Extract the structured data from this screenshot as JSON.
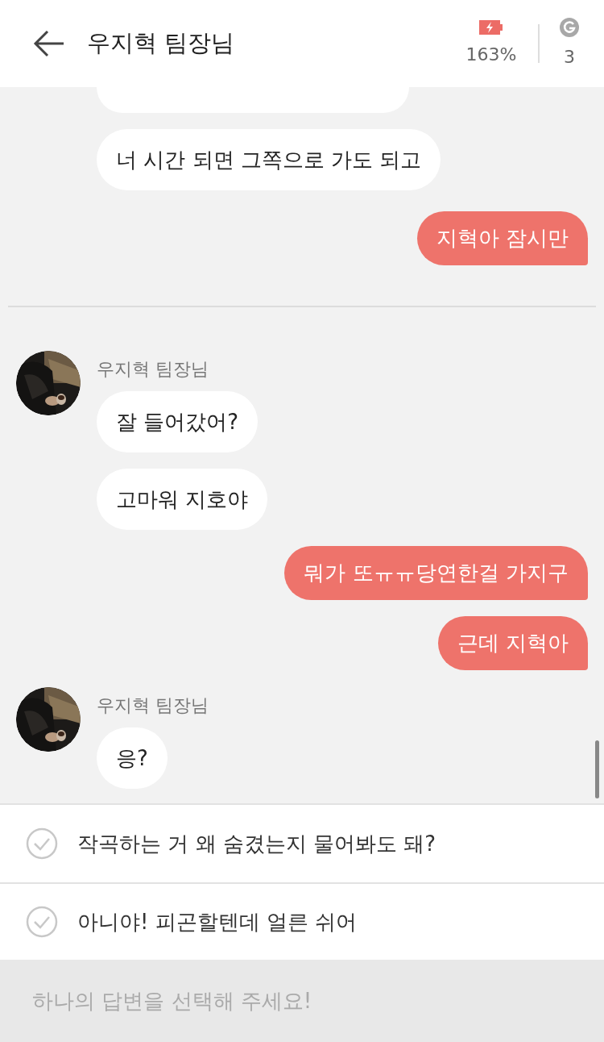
{
  "header": {
    "title": "우지혁 팀장님",
    "battery": "163%",
    "count": "3"
  },
  "messages": [
    {
      "kind": "partial"
    },
    {
      "kind": "received",
      "text": "너 시간 되면 그쪽으로 가도 되고"
    },
    {
      "kind": "sent",
      "text": "지혁아 잠시만"
    },
    {
      "kind": "divider"
    },
    {
      "kind": "group",
      "sender": "우지혁 팀장님",
      "texts": [
        "잘 들어갔어?",
        "고마워 지호야"
      ]
    },
    {
      "kind": "sent",
      "text": "뭐가 또ㅠㅠ당연한걸 가지구"
    },
    {
      "kind": "sent",
      "text": "근데 지혁아"
    },
    {
      "kind": "group",
      "sender": "우지혁 팀장님",
      "texts": [
        "응?"
      ]
    }
  ],
  "options": [
    {
      "text": "작곡하는 거 왜 숨겼는지 물어봐도 돼?",
      "selected": false
    },
    {
      "text": "아니야! 피곤할텐데 얼른 쉬어",
      "selected": false
    }
  ],
  "footer": {
    "placeholder": "하나의 답변을 선택해 주세요!"
  }
}
